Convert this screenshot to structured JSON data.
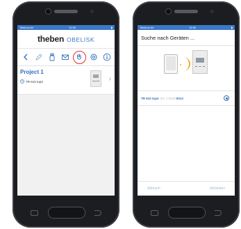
{
  "left_phone": {
    "status_bar": {
      "carrier": "Telekom.de",
      "time": "11:55"
    },
    "app": {
      "brand": "theben",
      "product": "OBELISK"
    },
    "toolbar": {
      "icons": [
        "pencil-icon",
        "bottle-icon",
        "envelope-icon",
        "hand-icon",
        "gear-icon",
        "info-icon"
      ],
      "active": "hand-icon"
    },
    "project": {
      "title": "Project 1",
      "device": "TR 610 top3"
    }
  },
  "right_phone": {
    "status_bar": {
      "carrier": "Telekom.de",
      "time": "11:56"
    },
    "title": "Suche nach Geräten ...",
    "device_row": {
      "name": "TR 610 top3",
      "sn_label": "SN",
      "sn_prefix": "170200",
      "sn_suffix": "0013"
    },
    "actions": {
      "cancel": "Abbruch",
      "connect": "Verbinden"
    }
  },
  "colors": {
    "accent_blue": "#2f6fba",
    "active_red": "#e52b2b",
    "signal_orange": "#f3a81c"
  }
}
